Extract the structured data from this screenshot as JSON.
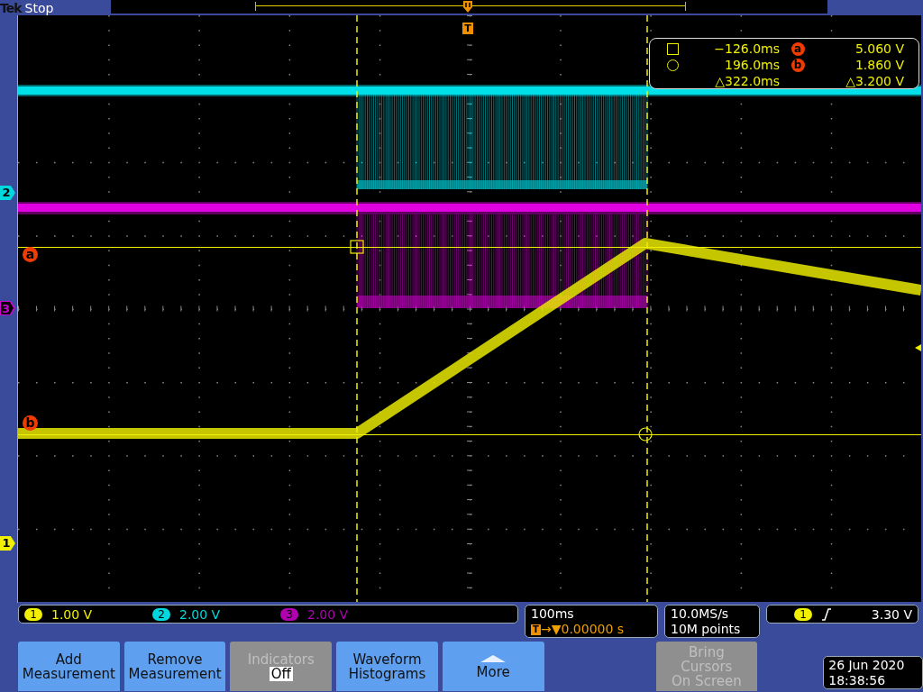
{
  "top_bar": {
    "brand": "Tek",
    "status": "Stop"
  },
  "trigger_marker": "T",
  "channel_markers": [
    {
      "label": "2",
      "color": "#00d8e0"
    },
    {
      "label": "3",
      "color": "#d000d0"
    },
    {
      "label": "1",
      "color": "#f0f000"
    }
  ],
  "cursor_markers": [
    "a",
    "b"
  ],
  "cursor_readout": {
    "rows": [
      {
        "time": "−126.0ms",
        "marker": "a",
        "value": "5.060 V"
      },
      {
        "time": "196.0ms",
        "marker": "b",
        "value": "1.860 V"
      }
    ],
    "delta_time": "△322.0ms",
    "delta_value": "△3.200 V"
  },
  "channels": [
    {
      "number": "1",
      "scale": "1.00 V",
      "color": "#f0f000"
    },
    {
      "number": "2",
      "scale": "2.00 V",
      "color": "#00d8e0"
    },
    {
      "number": "3",
      "scale": "2.00 V",
      "color": "#b000b0"
    }
  ],
  "horizontal": {
    "scale": "100ms",
    "trigger_badge": "T",
    "delay": "→▼0.00000 s"
  },
  "acquisition": {
    "rate": "10.0MS/s",
    "record": "10M points"
  },
  "trigger": {
    "source": "1",
    "level": "3.30 V"
  },
  "buttons": [
    {
      "kind": "action",
      "lines": [
        "Add",
        "Measurement"
      ],
      "disabled": false
    },
    {
      "kind": "action",
      "lines": [
        "Remove",
        "Measurement"
      ],
      "disabled": false
    },
    {
      "kind": "toggle",
      "lines": [
        "Indicators"
      ],
      "value": "Off",
      "disabled": true
    },
    {
      "kind": "action",
      "lines": [
        "Waveform",
        "Histograms"
      ],
      "disabled": false
    },
    {
      "kind": "menu",
      "lines": [
        "More"
      ],
      "disabled": false
    },
    {
      "kind": "action",
      "lines": [
        "Bring",
        "Cursors",
        "On Screen"
      ],
      "disabled": true
    }
  ],
  "clock": {
    "date": "26 Jun 2020",
    "time": "18:38:56"
  }
}
